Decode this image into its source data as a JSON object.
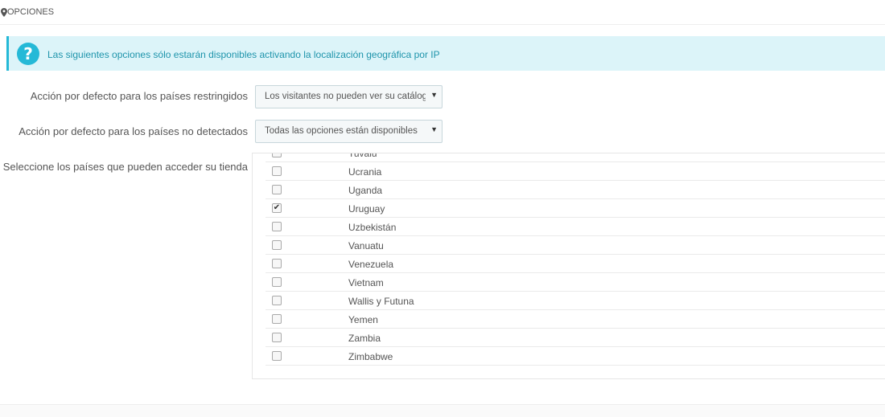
{
  "panel": {
    "title": "OPCIONES",
    "icon": "map-pin-icon"
  },
  "alert": {
    "icon": "question-icon",
    "icon_glyph": "?",
    "text": "Las siguientes opciones sólo estarán disponibles activando la localización geográfica por IP"
  },
  "fields": {
    "restricted_label": "Acción por defecto para los países restringidos",
    "restricted_value": "Los visitantes no pueden ver su catálogo.",
    "undetected_label": "Acción por defecto para los países no detectados",
    "undetected_value": "Todas las opciones están disponibles",
    "countries_label": "Seleccione los países que pueden acceder su tienda",
    "caret": "▼"
  },
  "countries": [
    {
      "name": "Tuvalu",
      "checked": false
    },
    {
      "name": "Ucrania",
      "checked": false
    },
    {
      "name": "Uganda",
      "checked": false
    },
    {
      "name": "Uruguay",
      "checked": true
    },
    {
      "name": "Uzbekistán",
      "checked": false
    },
    {
      "name": "Vanuatu",
      "checked": false
    },
    {
      "name": "Venezuela",
      "checked": false
    },
    {
      "name": "Vietnam",
      "checked": false
    },
    {
      "name": "Wallis y Futuna",
      "checked": false
    },
    {
      "name": "Yemen",
      "checked": false
    },
    {
      "name": "Zambia",
      "checked": false
    },
    {
      "name": "Zimbabwe",
      "checked": false
    }
  ],
  "colors": {
    "info_accent": "#25b9d7",
    "info_bg": "#dcf4f9",
    "info_text": "#1e94ab"
  }
}
